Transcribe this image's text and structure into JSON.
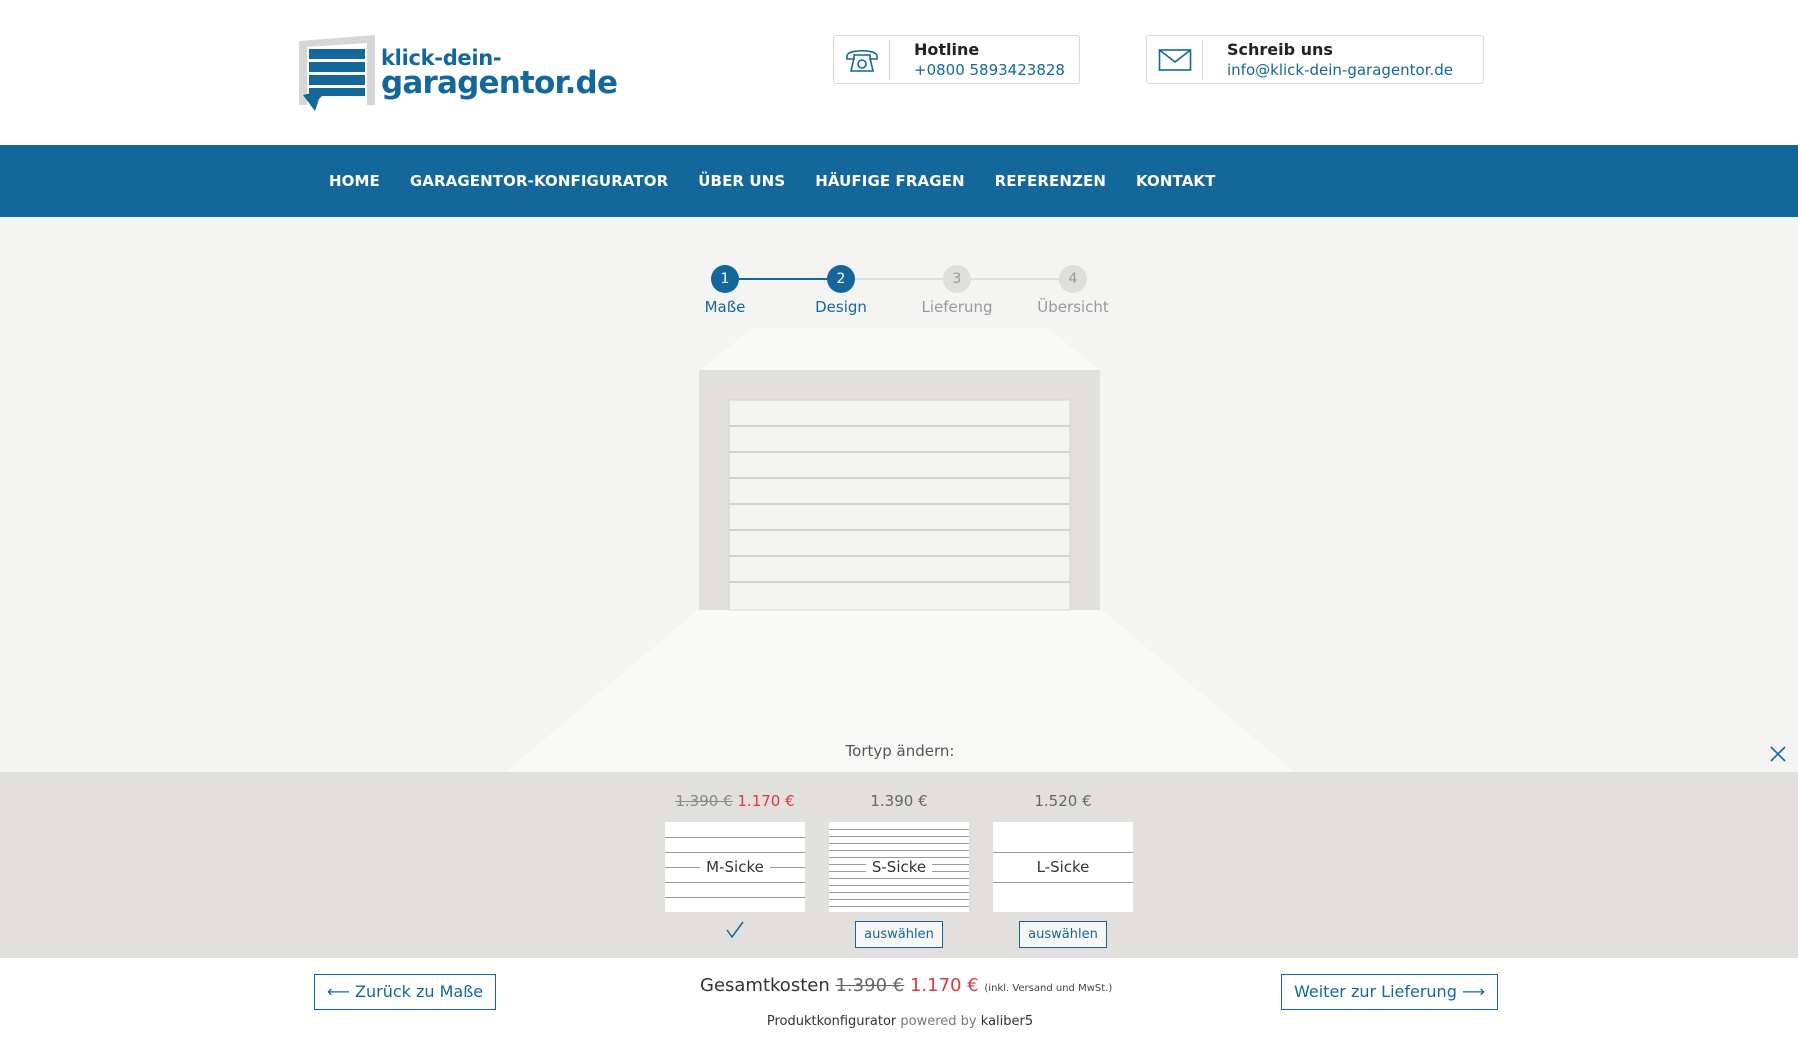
{
  "logo": {
    "line1": "klick-dein-",
    "line2": "garagentor.de"
  },
  "contact": {
    "hotline_label": "Hotline",
    "hotline_value": "+0800 5893423828",
    "mail_label": "Schreib uns",
    "mail_value": "info@klick-dein-garagentor.de"
  },
  "nav": [
    "HOME",
    "GARAGENTOR-KONFIGURATOR",
    "ÜBER UNS",
    "HÄUFIGE FRAGEN",
    "REFERENZEN",
    "KONTAKT"
  ],
  "steps": [
    {
      "num": "1",
      "label": "Maße",
      "active": true
    },
    {
      "num": "2",
      "label": "Design",
      "active": true
    },
    {
      "num": "3",
      "label": "Lieferung",
      "active": false
    },
    {
      "num": "4",
      "label": "Übersicht",
      "active": false
    }
  ],
  "tortyp_label": "Tortyp ändern:",
  "options": [
    {
      "name": "M-Sicke",
      "price_old": "1.390 €",
      "price_new": "1.170 €",
      "price": "",
      "selected": true,
      "action": ""
    },
    {
      "name": "S-Sicke",
      "price_old": "",
      "price_new": "",
      "price": "1.390 €",
      "selected": false,
      "action": "auswählen"
    },
    {
      "name": "L-Sicke",
      "price_old": "",
      "price_new": "",
      "price": "1.520 €",
      "selected": false,
      "action": "auswählen"
    }
  ],
  "footer": {
    "back_label": "⟵ Zurück zu Maße",
    "next_label": "Weiter zur Lieferung ⟶",
    "total_label": "Gesamtkosten",
    "total_old": "1.390 €",
    "total_new": "1.170 €",
    "total_note": "(inkl. Versand und MwSt.)",
    "powered_product": "Produktkonfigurator",
    "powered_by": "powered by",
    "powered_brand": "kaliber5"
  },
  "colors": {
    "brand": "#14679a",
    "sale": "#e0383f",
    "panel": "#e1e0dc"
  }
}
